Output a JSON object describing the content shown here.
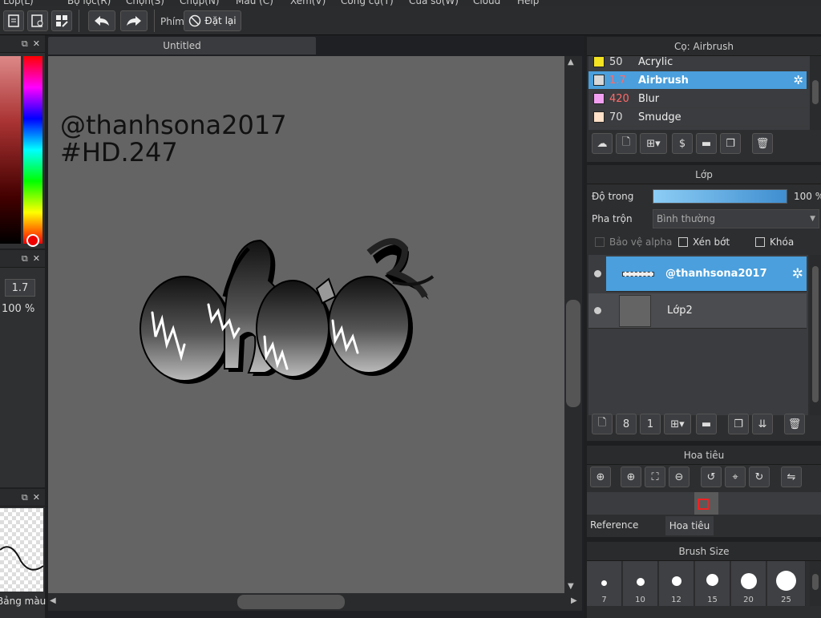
{
  "menu": [
    "Lớp(L)",
    "Bộ lọc(R)",
    "Chọn(S)",
    "Chụp(N)",
    "Màu (C)",
    "Xem(V)",
    "Công cụ(T)",
    "Cửa sổ(W)",
    "Cloud",
    "Help"
  ],
  "toolbar": {
    "key_label": "Phím",
    "reset_label": "Đặt lại"
  },
  "left": {
    "brush_size_value": "1.7",
    "opacity_value": "100 %",
    "palette_label": "Bảng màu"
  },
  "canvas": {
    "tab_title": "Untitled",
    "watermark_line1": "@thanhsona2017",
    "watermark_line2": "#HD.247"
  },
  "brush_panel": {
    "title": "Cọ: Airbrush",
    "items": [
      {
        "size": "50",
        "name": "Acrylic",
        "color": "#f3e321"
      },
      {
        "size": "1.7",
        "name": "Airbrush",
        "color": "#d8d8d8"
      },
      {
        "size": "420",
        "name": "Blur",
        "color": "#f29ff2"
      },
      {
        "size": "70",
        "name": "Smudge",
        "color": "#ffe0c8"
      }
    ]
  },
  "layer_panel": {
    "title": "Lớp",
    "opacity_label": "Độ trong",
    "opacity_value": "100 %",
    "opacity_level": 1.0,
    "blend_label": "Pha trộn",
    "blend_value": "Bình thường",
    "protect_alpha": "Bảo vệ alpha",
    "clipping": "Xén bớt",
    "lock": "Khóa",
    "layers": [
      {
        "name": "@thanhsona2017",
        "selected": true
      },
      {
        "name": "Lớp2",
        "selected": false
      }
    ]
  },
  "navigator": {
    "title": "Hoa tiêu",
    "tab_reference": "Reference",
    "tab_navigator": "Hoa tiêu"
  },
  "brush_size_panel": {
    "title": "Brush Size",
    "sizes": [
      "7",
      "10",
      "12",
      "15",
      "20",
      "25"
    ]
  },
  "colors": {
    "accent": "#4a9fdc",
    "selected_brush_size": "#ff6b6b"
  }
}
